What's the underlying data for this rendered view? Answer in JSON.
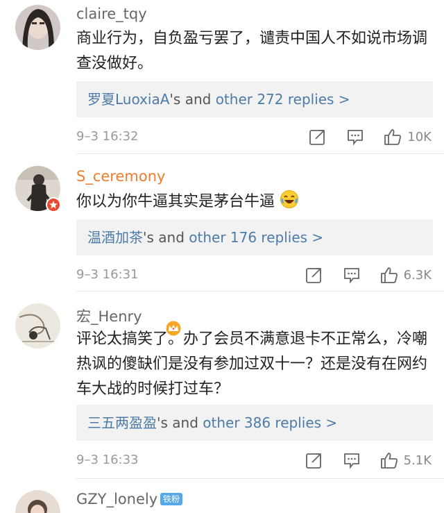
{
  "comments": [
    {
      "username": "claire_tqy",
      "text": "商业行为，自负盈亏罢了，谴责中国人不如说市场调查没做好。",
      "reply_user": "罗夏LuoxiaA",
      "reply_mid": "'s and ",
      "reply_more": "other 272 replies >",
      "time": "9–3 16:32",
      "likes": "10K"
    },
    {
      "username": "S_ceremony",
      "text": "你以为你牛逼其实是茅台牛逼",
      "reply_user": "温酒加茶",
      "reply_mid": "'s and ",
      "reply_more": "other 176 replies >",
      "time": "9–3 16:31",
      "likes": "6.3K"
    },
    {
      "username": "宏_Henry",
      "text": "评论太搞笑了。办了会员不满意退卡不正常么，冷嘲热讽的傻缺们是没有参加过双十一？还是没有在网约车大战的时候打过车？",
      "reply_user": "三五两盈盈",
      "reply_mid": "'s and ",
      "reply_more": "other 386 replies >",
      "time": "9–3 16:33",
      "likes": "5.1K"
    },
    {
      "username": "GZY_lonely",
      "fan_badge": "铁粉"
    }
  ],
  "icons": {
    "share": "share-icon",
    "comment": "comment-icon",
    "like": "thumbs-up-icon",
    "crown": "crown-icon",
    "emoji": "laughing-emoji-icon"
  },
  "colors": {
    "link_blue": "#4d7ba8",
    "vip_orange": "#f07c2c",
    "badge_blue": "#56a7e8"
  }
}
